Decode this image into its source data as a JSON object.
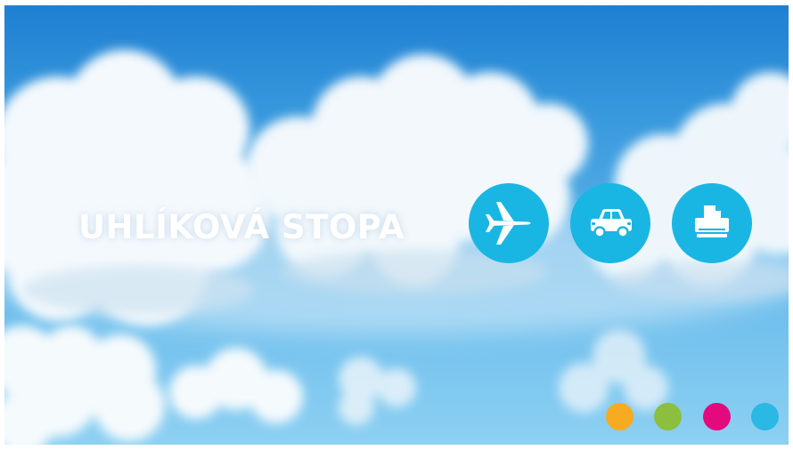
{
  "slide": {
    "title": "UHLÍKOVÁ STOPA"
  },
  "icons": [
    {
      "name": "airplane-icon",
      "color": "#1ab6e3"
    },
    {
      "name": "car-icon",
      "color": "#1ab6e3"
    },
    {
      "name": "printer-icon",
      "color": "#1ab6e3"
    }
  ],
  "dots": [
    {
      "color": "#f7ab22"
    },
    {
      "color": "#8cbf3f"
    },
    {
      "color": "#e4097d"
    },
    {
      "color": "#2bb8e5"
    }
  ],
  "colors": {
    "sky_top": "#1f7fd2",
    "sky_bottom": "#8dd0f2",
    "title": "#ffffff",
    "icon_fill": "#ffffff"
  }
}
